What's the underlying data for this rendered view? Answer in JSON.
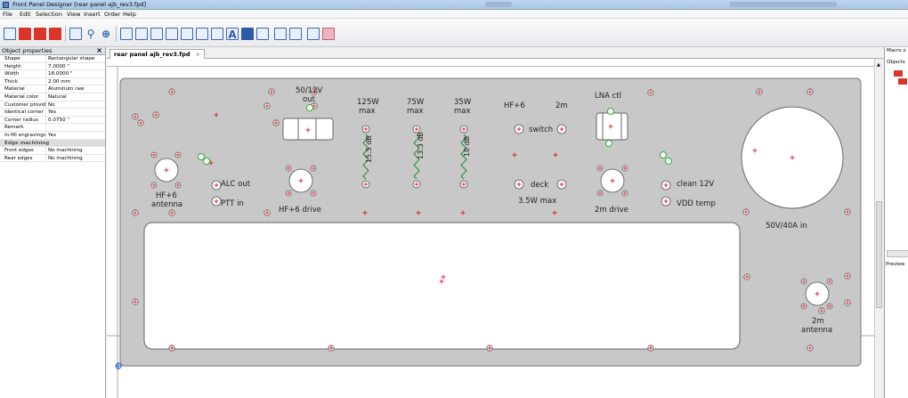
{
  "window": {
    "title": "Front Panel Designer [rear panel ajb_rev3.fpd]"
  },
  "menu": [
    "File",
    "Edit",
    "Selection",
    "View",
    "Insert",
    "Order",
    "Help"
  ],
  "properties": {
    "header": "Object properties",
    "rows": [
      {
        "k": "Shape",
        "v": "Rectangular shape"
      },
      {
        "k": "Height",
        "v": "7.0000 \""
      },
      {
        "k": "Width",
        "v": "18.0000 \""
      },
      {
        "k": "Thick.",
        "v": "2.00 mm"
      },
      {
        "k": "Material",
        "v": "Aluminum raw"
      },
      {
        "k": "Material color",
        "v": "Natural"
      },
      {
        "k": "Customer provid",
        "v": "No"
      },
      {
        "k": "Identical corner",
        "v": "Yes"
      },
      {
        "k": "Corner radius",
        "v": "0.0750 \""
      },
      {
        "k": "Remark",
        "v": ""
      },
      {
        "k": "In-fill engravings",
        "v": "Yes"
      },
      {
        "k": "Edge machining",
        "v": "",
        "group": true
      },
      {
        "k": "Front edges",
        "v": "No machining"
      },
      {
        "k": "Rear edges",
        "v": "No machining"
      }
    ]
  },
  "doc_tab": "rear panel ajb_rev3.fpd",
  "right_panel": {
    "macro": "Macro o",
    "objects": "Objects",
    "preview": "Preview"
  },
  "labels": {
    "out_5012": "50/12V",
    "out": "out",
    "w125": "125W",
    "max": "max",
    "w75": "75W",
    "w35": "35W",
    "hf6": "HF+6",
    "m2": "2m",
    "lna": "LNA ctl",
    "switch": "switch",
    "deck": "deck",
    "w35max": "3.5W max",
    "db155": "15.5 dB",
    "db133": "13.3 dB",
    "db10": "10 dB",
    "hf6b": "HF+6",
    "antenna": "antenna",
    "alc": "ALC out",
    "ptt": "PTT in",
    "hf6drive": "HF+6 drive",
    "m2drive": "2m drive",
    "clean": "clean 12V",
    "vdd": "VDD temp",
    "v50": "50V/40A in",
    "m2b": "2m",
    "antenna2": "antenna"
  },
  "colors": {
    "panel": "#c8c8c8",
    "hole": "#fff",
    "marker": "#e00000",
    "resistor": "#2a8a2a",
    "slot": "#fff"
  }
}
